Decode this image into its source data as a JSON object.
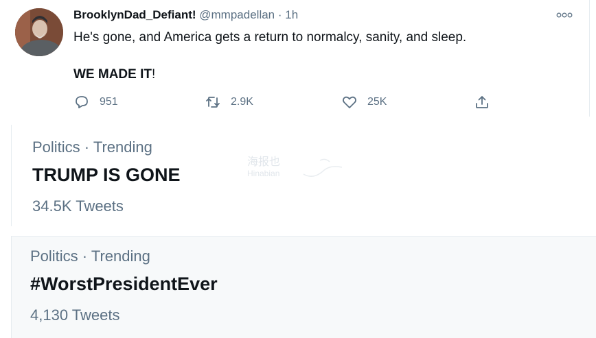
{
  "tweet": {
    "display_name": "BrooklynDad_Defiant!",
    "handle": "@mmpadellan",
    "separator": "·",
    "time": "1h",
    "text_line1": "He's gone, and America gets a return to normalcy, sanity, and sleep.",
    "text_line2": "WE MADE IT",
    "text_line2_end": "!",
    "more_icon": "more-horizontal-icon",
    "actions": {
      "replies": "951",
      "retweets": "2.9K",
      "likes": "25K"
    }
  },
  "trends": [
    {
      "meta": "Politics · Trending",
      "title": "TRUMP IS GONE",
      "count": "34.5K Tweets"
    },
    {
      "meta": "Politics · Trending",
      "title": "#WorstPresidentEver",
      "count": "4,130 Tweets"
    }
  ],
  "watermark": {
    "line1": "海报也",
    "line2": "Hinabian"
  }
}
